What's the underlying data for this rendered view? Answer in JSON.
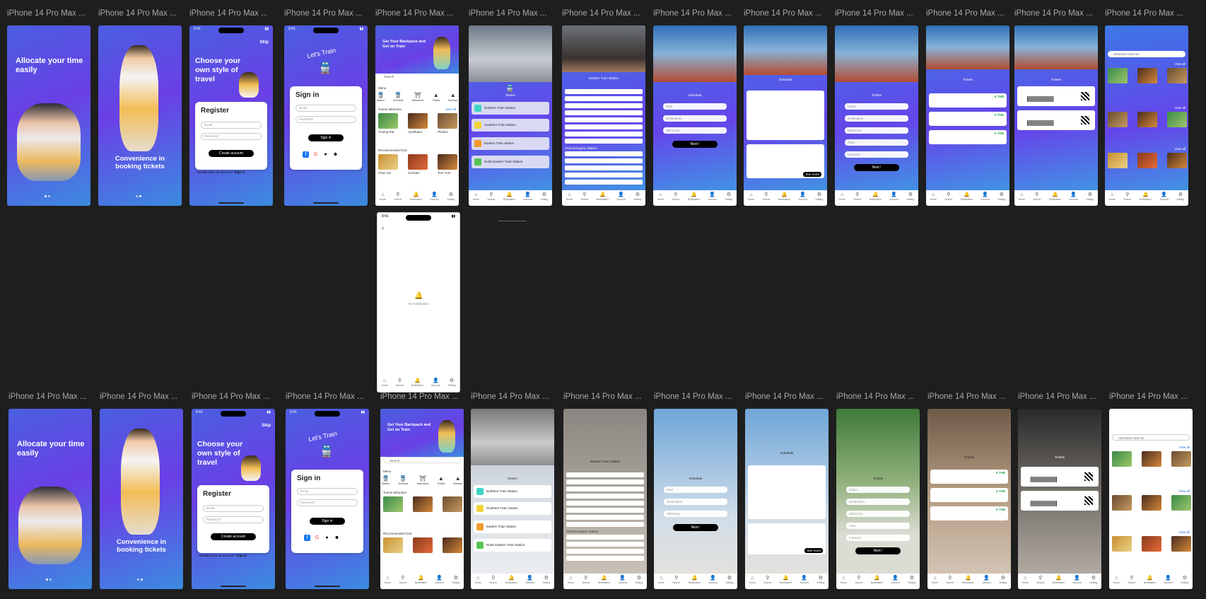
{
  "canvas": {
    "background": "#1e1e1e"
  },
  "frame_label": "iPhone 14 Pro Max ...",
  "status": {
    "time": "9:41"
  },
  "onboarding": {
    "slide1_title": "Allocate your time easily",
    "slide2_title": "Convenience in booking tickets"
  },
  "register": {
    "skip": "Skip",
    "headline": "Choose your own style of travel",
    "title": "Register",
    "email_placeholder": "Email",
    "password_placeholder": "Password",
    "create_button": "Create account",
    "footer_text": "Already have an account?",
    "footer_link": "Sign in"
  },
  "signin": {
    "brand": "Let's Train",
    "title": "Sign in",
    "email_placeholder": "Email",
    "password_placeholder": "Password",
    "button": "Sign in"
  },
  "home": {
    "hero": "Get Your Backpack and Get on Train",
    "search_placeholder": "Search",
    "menu_label": "Menu",
    "menu_items": [
      "Station",
      "Schedule",
      "Attractions",
      "Tickets",
      "Itinerary"
    ],
    "tourist_label": "Tourist attraction",
    "food_label": "Recommended food",
    "view_all": "View all",
    "place_names": [
      "Chiang Rai",
      "Ayutthaya",
      "Phuket"
    ],
    "food_names": [
      "Khao Soi",
      "Somtam",
      "Tom Yum"
    ]
  },
  "station_list": {
    "title": "Station",
    "items": [
      "Northern Train Station",
      "Southern Train Station",
      "Eastern Train Station",
      "North Eastern Train Station"
    ]
  },
  "eastern_station": {
    "title": "Eastern Train Station",
    "section": "Chachoengsao Station"
  },
  "schedule": {
    "title": "Schedule",
    "start_placeholder": "Start",
    "destination_placeholder": "Destination",
    "date_placeholder": "dd/mm/yy",
    "next_button": "Next !",
    "see_more": "See more"
  },
  "tickets": {
    "title": "Tickets",
    "origin_placeholder": "Origin",
    "destination_placeholder": "Destination",
    "date_placeholder": "dd/mm/yy",
    "time_placeholder": "Time",
    "person_placeholder": "# person",
    "next_button": "Next !",
    "price": "6 THB"
  },
  "itinerary": {
    "search_text": "Attraction near me",
    "view_all": "View all"
  },
  "notification": {
    "empty_text": "No Notification"
  },
  "tabbar": [
    {
      "label": "Home",
      "icon": "⌂"
    },
    {
      "label": "Search",
      "icon": "⚲"
    },
    {
      "label": "Notification",
      "icon": "🔔"
    },
    {
      "label": "Account",
      "icon": "👤"
    },
    {
      "label": "Setting",
      "icon": "⚙"
    }
  ]
}
